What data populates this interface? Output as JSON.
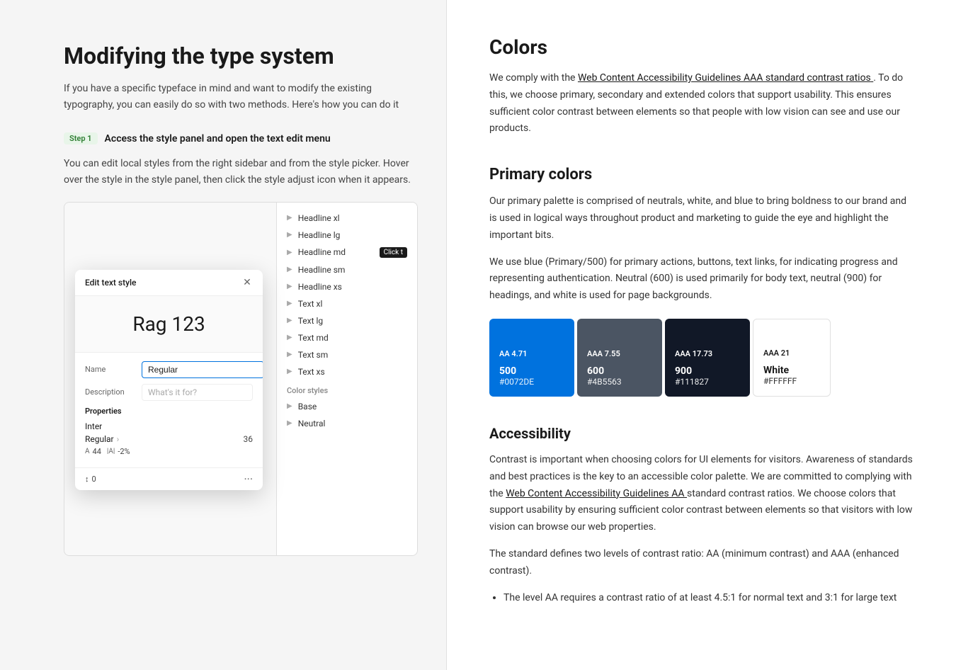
{
  "leftPanel": {
    "title": "Modifying the type system",
    "subtitle": "If you have a specific typeface in mind and want to modify the existing typography, you can easily do so with two methods. Here's how you can do it",
    "step": {
      "badge": "Step 1",
      "label": "Access the style panel and open the text edit menu",
      "description": "You can edit local styles from the right sidebar and from the style picker. Hover over the style in the style panel, then click the style adjust icon when it appears."
    }
  },
  "modal": {
    "title": "Edit text style",
    "preview": "Rag 123",
    "nameLabel": "Name",
    "nameValue": "Regular",
    "descLabel": "Description",
    "descPlaceholder": "What's it for?",
    "propertiesLabel": "Properties",
    "fontFamily": "Inter",
    "fontStyle": "Regular",
    "fontSize": "36",
    "lineHeight": "44",
    "letterSpacing": "-2%",
    "paragraphSpacing": "0"
  },
  "stylesList": {
    "items": [
      {
        "name": "Headline xl",
        "detail": ""
      },
      {
        "name": "Headline lg",
        "detail": ""
      },
      {
        "name": "Headline md",
        "detail": ""
      },
      {
        "name": "Headline sm",
        "detail": ""
      },
      {
        "name": "Headline xs",
        "detail": ""
      },
      {
        "name": "Text xl",
        "detail": ""
      },
      {
        "name": "Text lg",
        "detail": ""
      },
      {
        "name": "Text md",
        "detail": ""
      },
      {
        "name": "Text sm",
        "detail": ""
      },
      {
        "name": "Text xs",
        "detail": ""
      }
    ],
    "colorSection": "Color styles",
    "colorItems": [
      {
        "name": "Base"
      },
      {
        "name": "Neutral"
      }
    ]
  },
  "clickTooltip": "Click t",
  "rightPanel": {
    "colorsTitle": "Colors",
    "colorsIntro": "We comply with the",
    "colorsLink": "Web Content Accessibility Guidelines AAA standard contrast ratios",
    "colorsIntro2": ". To do this, we choose primary, secondary and extended colors that support usability. This ensures sufficient color contrast between elements so that people with low vision can see and use our products.",
    "primaryTitle": "Primary colors",
    "primaryDesc1": "Our primary palette is comprised of neutrals, white, and blue to bring boldness to our brand and is used in logical ways throughout product and marketing to guide the eye and highlight the important bits.",
    "primaryDesc2": "We use blue (Primary/500) for primary actions, buttons, text links, for indicating progress and representing authentication. Neutral (600) is used primarily for body text, neutral (900) for headings, and white is used for page backgrounds.",
    "swatches": [
      {
        "contrast": "AA 4.71",
        "name": "500",
        "hex": "#0072DE",
        "bg": "#0072DE",
        "textColor": "#fff"
      },
      {
        "contrast": "AAA 7.55",
        "name": "600",
        "hex": "#4B5563",
        "bg": "#4B5563",
        "textColor": "#fff"
      },
      {
        "contrast": "AAA 17.73",
        "name": "900",
        "hex": "#111827",
        "bg": "#111827",
        "textColor": "#fff"
      },
      {
        "contrast": "AAA 21",
        "name": "White",
        "hex": "#FFFFFF",
        "bg": "#FFFFFF",
        "textColor": "#1a1a1a"
      }
    ],
    "accessibilityTitle": "Accessibility",
    "accessibilityDesc1": "Contrast is important when choosing colors for UI elements for visitors. Awareness of standards and best practices is the key to an accessible color palette. We are committed to complying with the",
    "accessibilityLink": "Web Content Accessibility Guidelines AA",
    "accessibilityDesc2": "standard contrast ratios. We choose colors that support usability by ensuring sufficient color contrast between elements so that visitors with low vision can browse our web properties.",
    "accessibilityDesc3": "The standard defines two levels of contrast ratio: AA (minimum contrast) and AAA (enhanced contrast).",
    "bulletItems": [
      "The level AA requires a contrast ratio of at least 4.5:1 for normal text and 3:1 for large text"
    ]
  }
}
